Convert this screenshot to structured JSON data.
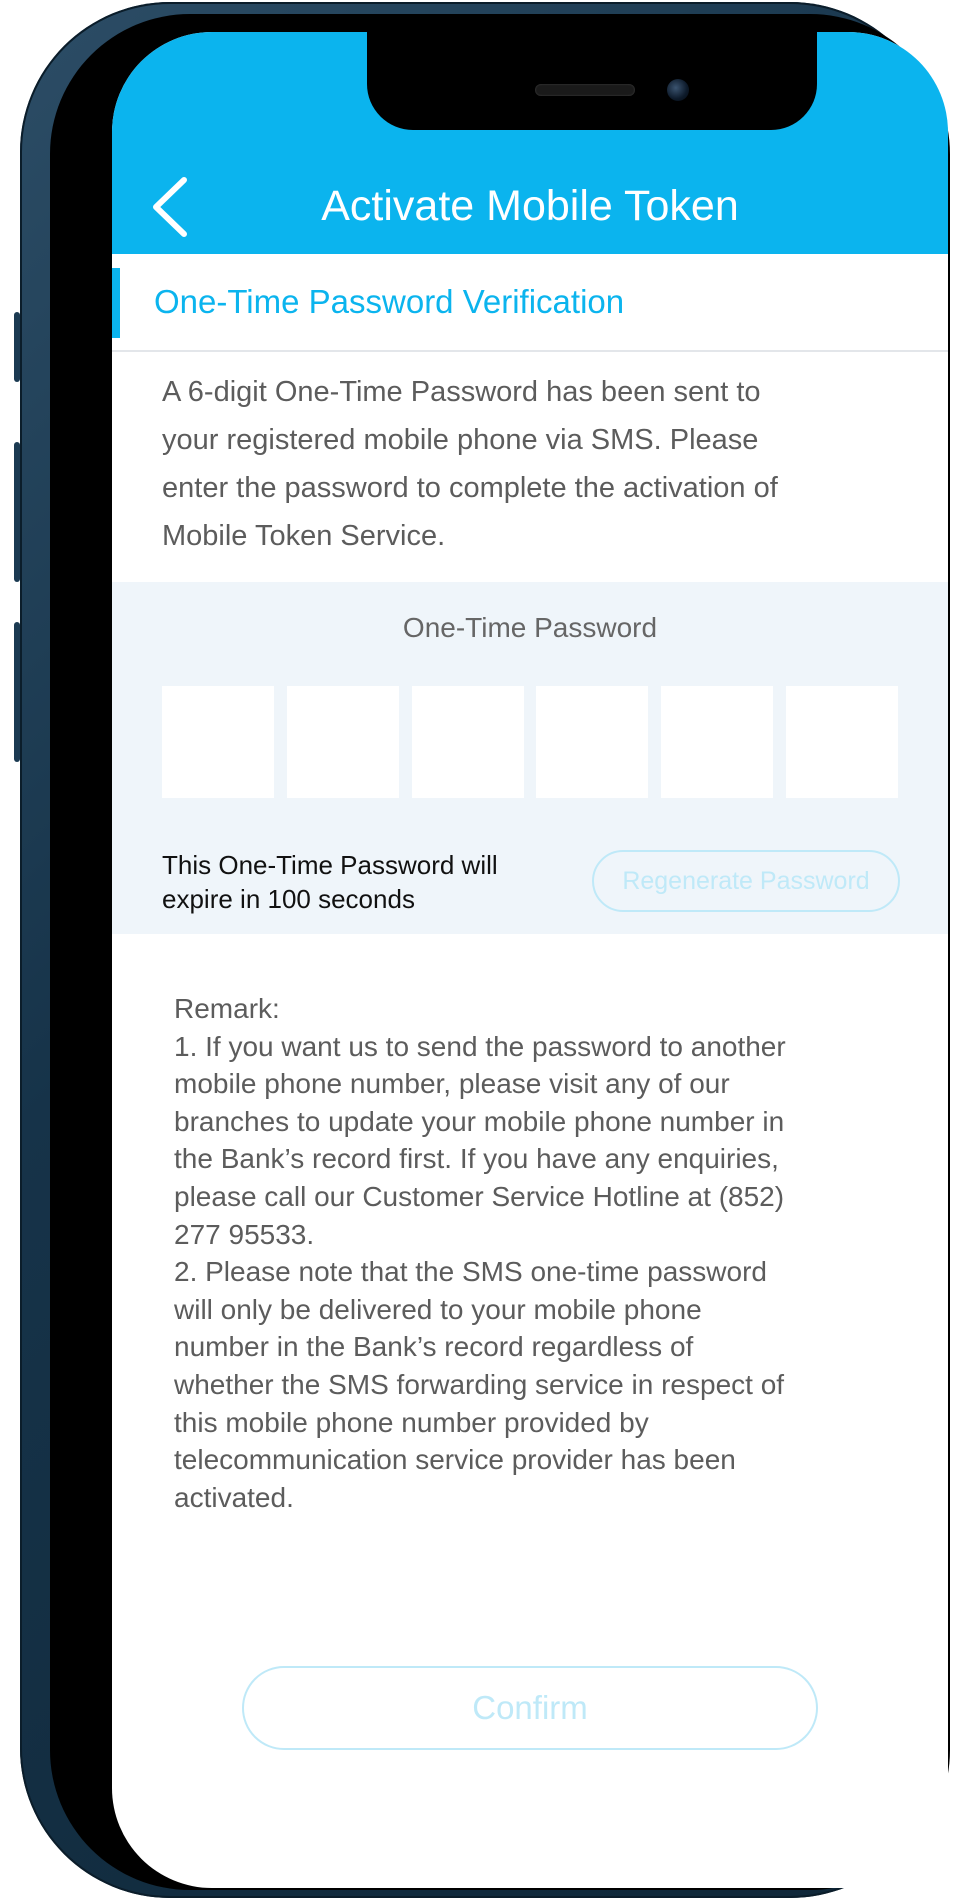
{
  "colors": {
    "brand": "#0bb4ee",
    "header_text": "#ffffff",
    "panel_bg": "#eff5fa",
    "disabled_button": "#bfe9f8",
    "body_text": "#5c5c5c"
  },
  "header": {
    "title": "Activate Mobile Token",
    "back_icon": "chevron-left-icon"
  },
  "section": {
    "title": "One-Time Password Verification"
  },
  "description": {
    "lines": [
      "A 6-digit One-Time Password has been sent to",
      "your registered mobile phone via SMS. Please",
      "enter the password to complete the activation of",
      "Mobile Token Service."
    ]
  },
  "otp": {
    "label": "One-Time Password",
    "digits": [
      "",
      "",
      "",
      "",
      "",
      ""
    ],
    "expiry_line1": "This One-Time Password will",
    "expiry_line2": "expire in  100 seconds",
    "regenerate_label": "Regenerate Password"
  },
  "remark": {
    "heading": "Remark:",
    "lines": [
      "1. If you want us to send the password to another",
      "mobile phone number, please visit any of our",
      "branches to update your mobile phone number in",
      "the Bank’s record first. If you have any enquiries,",
      "please call our Customer Service Hotline at (852)",
      "277 95533.",
      "2. Please note that the SMS one-time password",
      "will only be delivered to your mobile phone",
      "number in the Bank’s record regardless of",
      "whether the SMS forwarding service in respect of",
      "this mobile phone number provided by",
      "telecommunication service provider has been",
      "activated."
    ]
  },
  "actions": {
    "confirm_label": "Confirm"
  }
}
